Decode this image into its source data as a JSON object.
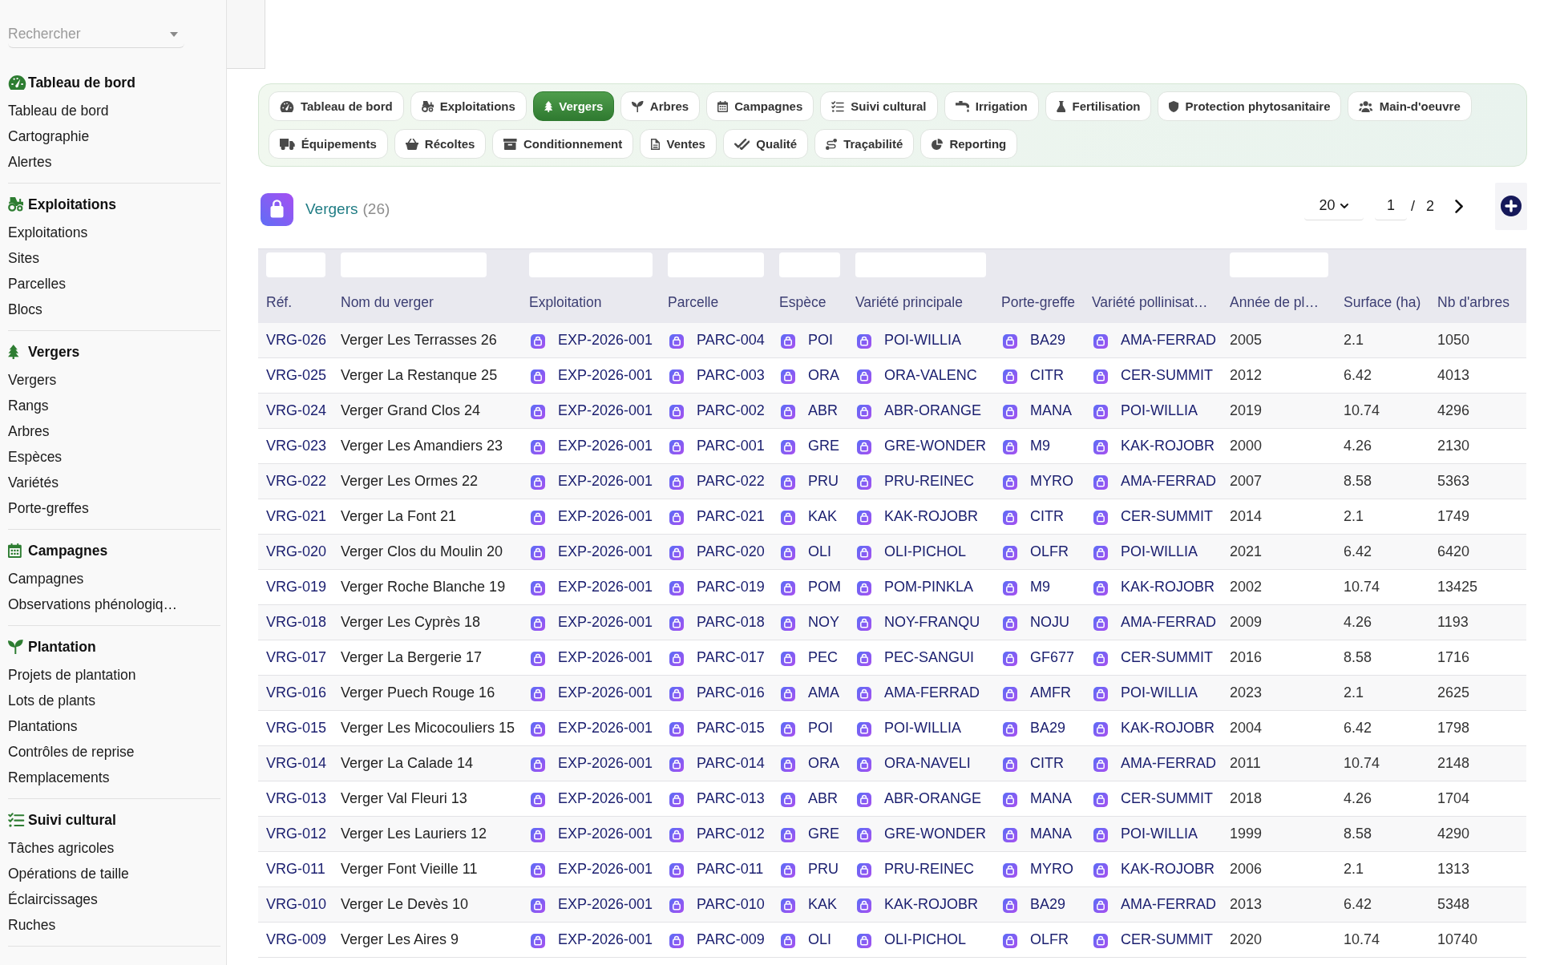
{
  "search": {
    "placeholder": "Rechercher"
  },
  "sidebar": {
    "sections": [
      {
        "title": "Tableau de bord",
        "items": [
          "Tableau de bord",
          "Cartographie",
          "Alertes"
        ]
      },
      {
        "title": "Exploitations",
        "items": [
          "Exploitations",
          "Sites",
          "Parcelles",
          "Blocs"
        ]
      },
      {
        "title": "Vergers",
        "items": [
          "Vergers",
          "Rangs",
          "Arbres",
          "Espèces",
          "Variétés",
          "Porte-greffes"
        ]
      },
      {
        "title": "Campagnes",
        "items": [
          "Campagnes",
          "Observations phénologiq…"
        ]
      },
      {
        "title": "Plantation",
        "items": [
          "Projets de plantation",
          "Lots de plants",
          "Plantations",
          "Contrôles de reprise",
          "Remplacements"
        ]
      },
      {
        "title": "Suivi cultural",
        "items": [
          "Tâches agricoles",
          "Opérations de taille",
          "Éclaircissages",
          "Ruches"
        ]
      }
    ]
  },
  "tabs": [
    {
      "label": "Tableau de bord",
      "selected": false
    },
    {
      "label": "Exploitations",
      "selected": false
    },
    {
      "label": "Vergers",
      "selected": true
    },
    {
      "label": "Arbres",
      "selected": false
    },
    {
      "label": "Campagnes",
      "selected": false
    },
    {
      "label": "Suivi cultural",
      "selected": false
    },
    {
      "label": "Irrigation",
      "selected": false
    },
    {
      "label": "Fertilisation",
      "selected": false
    },
    {
      "label": "Protection phytosanitaire",
      "selected": false
    },
    {
      "label": "Main-d'oeuvre",
      "selected": false
    },
    {
      "label": "Équipements",
      "selected": false
    },
    {
      "label": "Récoltes",
      "selected": false
    },
    {
      "label": "Conditionnement",
      "selected": false
    },
    {
      "label": "Ventes",
      "selected": false
    },
    {
      "label": "Qualité",
      "selected": false
    },
    {
      "label": "Traçabilité",
      "selected": false
    },
    {
      "label": "Reporting",
      "selected": false
    }
  ],
  "list_header": {
    "title": "Vergers",
    "count": "(26)"
  },
  "pagination": {
    "page_size": "20",
    "page": "1",
    "separator": "/",
    "total_pages": "2"
  },
  "table": {
    "columns": [
      {
        "label": "Réf.",
        "kind": "ref",
        "filter": true
      },
      {
        "label": "Nom du verger",
        "kind": "text",
        "filter": true
      },
      {
        "label": "Exploitation",
        "kind": "link",
        "filter": true
      },
      {
        "label": "Parcelle",
        "kind": "link",
        "filter": true
      },
      {
        "label": "Espèce",
        "kind": "link",
        "filter": true
      },
      {
        "label": "Variété principale",
        "kind": "link",
        "filter": true
      },
      {
        "label": "Porte-greffe",
        "kind": "link",
        "filter": false
      },
      {
        "label": "Variété pollinisat…",
        "kind": "link",
        "filter": false
      },
      {
        "label": "Année de pl…",
        "kind": "number",
        "filter": true
      },
      {
        "label": "Surface (ha)",
        "kind": "number",
        "filter": false
      },
      {
        "label": "Nb d'arbres",
        "kind": "number",
        "filter": false
      }
    ],
    "rows": [
      [
        "VRG-026",
        "Verger Les Terrasses 26",
        "EXP-2026-001",
        "PARC-004",
        "POI",
        "POI-WILLIA",
        "BA29",
        "AMA-FERRAD",
        "2005",
        "2.1",
        "1050"
      ],
      [
        "VRG-025",
        "Verger La Restanque 25",
        "EXP-2026-001",
        "PARC-003",
        "ORA",
        "ORA-VALENC",
        "CITR",
        "CER-SUMMIT",
        "2012",
        "6.42",
        "4013"
      ],
      [
        "VRG-024",
        "Verger Grand Clos 24",
        "EXP-2026-001",
        "PARC-002",
        "ABR",
        "ABR-ORANGE",
        "MANA",
        "POI-WILLIA",
        "2019",
        "10.74",
        "4296"
      ],
      [
        "VRG-023",
        "Verger Les Amandiers 23",
        "EXP-2026-001",
        "PARC-001",
        "GRE",
        "GRE-WONDER",
        "M9",
        "KAK-ROJOBR",
        "2000",
        "4.26",
        "2130"
      ],
      [
        "VRG-022",
        "Verger Les Ormes 22",
        "EXP-2026-001",
        "PARC-022",
        "PRU",
        "PRU-REINEC",
        "MYRO",
        "AMA-FERRAD",
        "2007",
        "8.58",
        "5363"
      ],
      [
        "VRG-021",
        "Verger La Font 21",
        "EXP-2026-001",
        "PARC-021",
        "KAK",
        "KAK-ROJOBR",
        "CITR",
        "CER-SUMMIT",
        "2014",
        "2.1",
        "1749"
      ],
      [
        "VRG-020",
        "Verger Clos du Moulin 20",
        "EXP-2026-001",
        "PARC-020",
        "OLI",
        "OLI-PICHOL",
        "OLFR",
        "POI-WILLIA",
        "2021",
        "6.42",
        "6420"
      ],
      [
        "VRG-019",
        "Verger Roche Blanche 19",
        "EXP-2026-001",
        "PARC-019",
        "POM",
        "POM-PINKLA",
        "M9",
        "KAK-ROJOBR",
        "2002",
        "10.74",
        "13425"
      ],
      [
        "VRG-018",
        "Verger Les Cyprès 18",
        "EXP-2026-001",
        "PARC-018",
        "NOY",
        "NOY-FRANQU",
        "NOJU",
        "AMA-FERRAD",
        "2009",
        "4.26",
        "1193"
      ],
      [
        "VRG-017",
        "Verger La Bergerie 17",
        "EXP-2026-001",
        "PARC-017",
        "PEC",
        "PEC-SANGUI",
        "GF677",
        "CER-SUMMIT",
        "2016",
        "8.58",
        "1716"
      ],
      [
        "VRG-016",
        "Verger Puech Rouge 16",
        "EXP-2026-001",
        "PARC-016",
        "AMA",
        "AMA-FERRAD",
        "AMFR",
        "POI-WILLIA",
        "2023",
        "2.1",
        "2625"
      ],
      [
        "VRG-015",
        "Verger Les Micocouliers 15",
        "EXP-2026-001",
        "PARC-015",
        "POI",
        "POI-WILLIA",
        "BA29",
        "KAK-ROJOBR",
        "2004",
        "6.42",
        "1798"
      ],
      [
        "VRG-014",
        "Verger La Calade 14",
        "EXP-2026-001",
        "PARC-014",
        "ORA",
        "ORA-NAVELI",
        "CITR",
        "AMA-FERRAD",
        "2011",
        "10.74",
        "2148"
      ],
      [
        "VRG-013",
        "Verger Val Fleuri 13",
        "EXP-2026-001",
        "PARC-013",
        "ABR",
        "ABR-ORANGE",
        "MANA",
        "CER-SUMMIT",
        "2018",
        "4.26",
        "1704"
      ],
      [
        "VRG-012",
        "Verger Les Lauriers 12",
        "EXP-2026-001",
        "PARC-012",
        "GRE",
        "GRE-WONDER",
        "MANA",
        "POI-WILLIA",
        "1999",
        "8.58",
        "4290"
      ],
      [
        "VRG-011",
        "Verger Font Vieille 11",
        "EXP-2026-001",
        "PARC-011",
        "PRU",
        "PRU-REINEC",
        "MYRO",
        "KAK-ROJOBR",
        "2006",
        "2.1",
        "1313"
      ],
      [
        "VRG-010",
        "Verger Le Devès 10",
        "EXP-2026-001",
        "PARC-010",
        "KAK",
        "KAK-ROJOBR",
        "BA29",
        "AMA-FERRAD",
        "2013",
        "6.42",
        "5348"
      ],
      [
        "VRG-009",
        "Verger Les Aires 9",
        "EXP-2026-001",
        "PARC-009",
        "OLI",
        "OLI-PICHOL",
        "OLFR",
        "CER-SUMMIT",
        "2020",
        "10.74",
        "10740"
      ]
    ]
  }
}
